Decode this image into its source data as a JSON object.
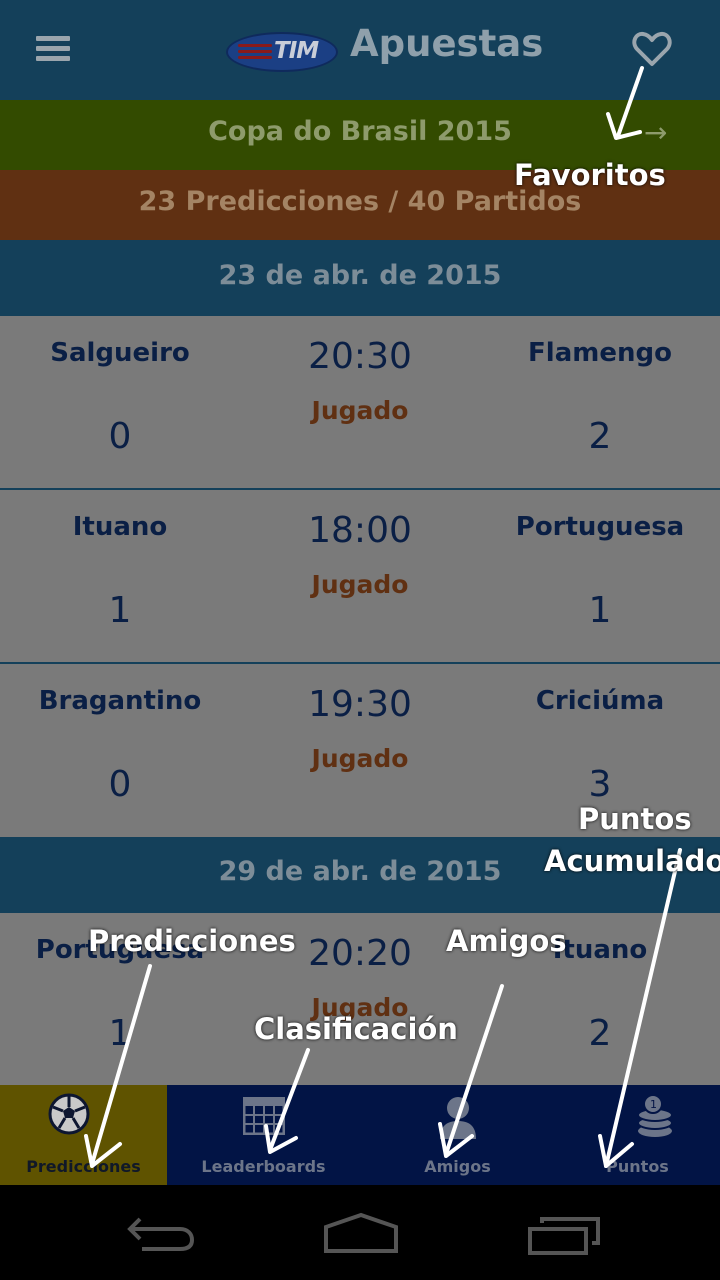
{
  "header": {
    "title": "Apuestas",
    "logo_text": "TIM"
  },
  "competition": {
    "title": "Copa do Brasil 2015"
  },
  "summary": {
    "text": "23 Predicciones / 40 Partidos"
  },
  "dates": [
    "23 de abr. de 2015",
    "29 de abr. de 2015"
  ],
  "matches": [
    {
      "home": "Salgueiro",
      "away": "Flamengo",
      "time": "20:30",
      "status": "Jugado",
      "home_score": "0",
      "away_score": "2"
    },
    {
      "home": "Ituano",
      "away": "Portuguesa",
      "time": "18:00",
      "status": "Jugado",
      "home_score": "1",
      "away_score": "1"
    },
    {
      "home": "Bragantino",
      "away": "Criciúma",
      "time": "19:30",
      "status": "Jugado",
      "home_score": "0",
      "away_score": "3"
    },
    {
      "home": "Portuguesa",
      "away": "Ituano",
      "time": "20:20",
      "status": "Jugado",
      "home_score": "1",
      "away_score": "2"
    }
  ],
  "nav": [
    {
      "label": "Predicciones",
      "icon": "soccer-ball-icon",
      "active": true
    },
    {
      "label": "Leaderboards",
      "icon": "grid-table-icon",
      "active": false
    },
    {
      "label": "Amigos",
      "icon": "person-icon",
      "active": false
    },
    {
      "label": "Puntos",
      "icon": "coins-icon",
      "active": false
    }
  ],
  "annotations": {
    "favoritos": "Favoritos",
    "puntos_line1": "Puntos",
    "puntos_line2": "Acumulados",
    "predicciones": "Predicciones",
    "amigos": "Amigos",
    "clasificacion": "Clasificación"
  },
  "colors": {
    "header": "#14405a",
    "competition": "#334b00",
    "summary": "#603012",
    "nav_bg": "#021445",
    "nav_active": "#5f5300"
  }
}
